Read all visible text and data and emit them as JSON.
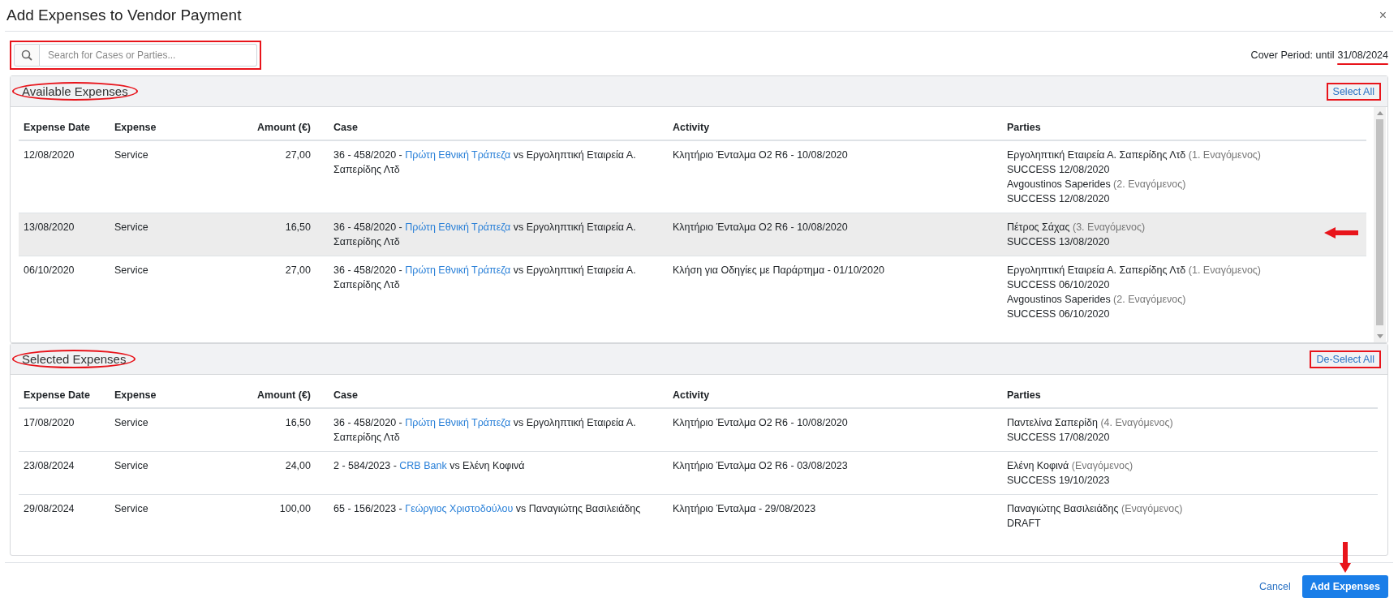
{
  "dialog": {
    "title": "Add Expenses to Vendor Payment",
    "close": "×"
  },
  "search": {
    "placeholder": "Search for Cases or Parties...",
    "boxed": true
  },
  "cover_period": {
    "label": "Cover Period: until",
    "date": "31/08/2024",
    "underlined": true
  },
  "sections": [
    {
      "title": "Available Expenses",
      "title_circled": true,
      "action": "Select All",
      "action_boxed": true,
      "scrollable": true,
      "columns": [
        "Expense Date",
        "Expense",
        "Amount (€)",
        "Case",
        "Activity",
        "Parties"
      ],
      "rows": [
        {
          "selected": false,
          "arrow": false,
          "date": "12/08/2020",
          "expense": "Service",
          "amount": "27,00",
          "case": {
            "prefix": "36 - 458/2020 - ",
            "link": "Πρώτη Εθνική Τράπεζα",
            "rest": " vs Εργοληπτική Εταιρεία Α. Σαπερίδης Λτδ"
          },
          "activity": "Κλητήριο Ένταλμα Ο2 R6 - 10/08/2020",
          "parties": [
            {
              "name": "Εργοληπτική Εταιρεία Α. Σαπερίδης Λτδ",
              "role": "(1. Εναγόμενος)",
              "status": "SUCCESS 12/08/2020"
            },
            {
              "name": "Avgoustinos Saperides",
              "role": "(2. Εναγόμενος)",
              "status": "SUCCESS 12/08/2020"
            }
          ]
        },
        {
          "selected": true,
          "arrow": true,
          "date": "13/08/2020",
          "expense": "Service",
          "amount": "16,50",
          "case": {
            "prefix": "36 - 458/2020 - ",
            "link": "Πρώτη Εθνική Τράπεζα",
            "rest": " vs Εργοληπτική Εταιρεία Α. Σαπερίδης Λτδ"
          },
          "activity": "Κλητήριο Ένταλμα Ο2 R6 - 10/08/2020",
          "parties": [
            {
              "name": "Πέτρος Σάχας",
              "role": "(3. Εναγόμενος)",
              "status": "SUCCESS 13/08/2020"
            }
          ]
        },
        {
          "selected": false,
          "arrow": false,
          "date": "06/10/2020",
          "expense": "Service",
          "amount": "27,00",
          "case": {
            "prefix": "36 - 458/2020 - ",
            "link": "Πρώτη Εθνική Τράπεζα",
            "rest": " vs Εργοληπτική Εταιρεία Α. Σαπερίδης Λτδ"
          },
          "activity": "Κλήση για Οδηγίες με Παράρτημα - 01/10/2020",
          "parties": [
            {
              "name": "Εργοληπτική Εταιρεία Α. Σαπερίδης Λτδ",
              "role": "(1. Εναγόμενος)",
              "status": "SUCCESS 06/10/2020"
            },
            {
              "name": "Avgoustinos Saperides",
              "role": "(2. Εναγόμενος)",
              "status": "SUCCESS 06/10/2020"
            }
          ]
        }
      ]
    },
    {
      "title": "Selected Expenses",
      "title_circled": true,
      "action": "De-Select All",
      "action_boxed": true,
      "columns": [
        "Expense Date",
        "Expense",
        "Amount (€)",
        "Case",
        "Activity",
        "Parties"
      ],
      "rows": [
        {
          "selected": false,
          "arrow": false,
          "date": "17/08/2020",
          "expense": "Service",
          "amount": "16,50",
          "case": {
            "prefix": "36 - 458/2020 - ",
            "link": "Πρώτη Εθνική Τράπεζα",
            "rest": " vs Εργοληπτική Εταιρεία Α. Σαπερίδης Λτδ"
          },
          "activity": "Κλητήριο Ένταλμα Ο2 R6 - 10/08/2020",
          "parties": [
            {
              "name": "Παντελίνα Σαπερίδη",
              "role": "(4. Εναγόμενος)",
              "status": "SUCCESS 17/08/2020"
            }
          ]
        },
        {
          "selected": false,
          "arrow": false,
          "date": "23/08/2024",
          "expense": "Service",
          "amount": "24,00",
          "case": {
            "prefix": "2 - 584/2023 - ",
            "link": "CRB Bank",
            "rest": " vs Ελένη Κοφινά"
          },
          "activity": "Κλητήριο Ένταλμα Ο2 R6 - 03/08/2023",
          "parties": [
            {
              "name": "Ελένη Κοφινά",
              "role": "(Εναγόμενος)",
              "status": "SUCCESS 19/10/2023"
            }
          ]
        },
        {
          "selected": false,
          "arrow": false,
          "date": "29/08/2024",
          "expense": "Service",
          "amount": "100,00",
          "case": {
            "prefix": "65 - 156/2023 - ",
            "link": "Γεώργιος Χριστοδούλου",
            "rest": " vs Παναγιώτης Βασιλειάδης"
          },
          "activity": "Κλητήριο Ένταλμα - 29/08/2023",
          "parties": [
            {
              "name": "Παναγιώτης Βασιλειάδης",
              "role": "(Εναγόμενος)",
              "status": "DRAFT"
            }
          ]
        }
      ]
    }
  ],
  "footer": {
    "cancel": "Cancel",
    "submit": "Add Expenses",
    "submit_arrow": true
  }
}
